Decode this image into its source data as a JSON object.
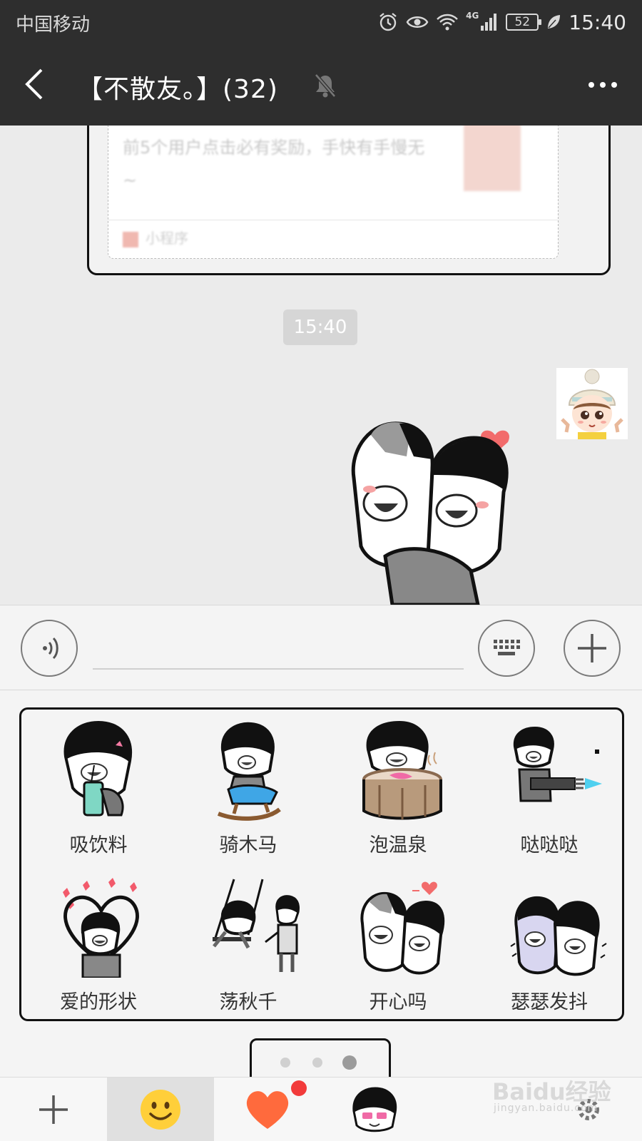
{
  "status_bar": {
    "carrier": "中国移动",
    "network_tag": "4G",
    "battery": "52",
    "time": "15:40"
  },
  "header": {
    "title": "【不散友。】(32)",
    "icons": [
      "back-arrow-icon",
      "mute-bell-icon",
      "more-dots-icon"
    ]
  },
  "chat": {
    "card_text": "前5个用户点击必有奖励，手快有手慢无~",
    "card_source": "小程序",
    "timestamp": "15:40"
  },
  "input": {
    "value": "",
    "icons": [
      "voice-icon",
      "keyboard-icon",
      "plus-icon"
    ]
  },
  "stickers": [
    {
      "label": "吸饮料"
    },
    {
      "label": "骑木马"
    },
    {
      "label": "泡温泉"
    },
    {
      "label": "哒哒哒"
    },
    {
      "label": "爱的形状"
    },
    {
      "label": "荡秋千"
    },
    {
      "label": "开心吗"
    },
    {
      "label": "瑟瑟发抖"
    }
  ],
  "pager": {
    "pages": 3,
    "current": 3
  },
  "tabbar": {
    "tabs": [
      "add-icon",
      "smiley-emoji-icon",
      "heart-icon",
      "mushroom-head-sticker-icon",
      "settings-gear-icon"
    ],
    "selected": "smiley-emoji-icon",
    "heart_tab_has_badge": true
  },
  "watermark": {
    "logo": "Baidu经验",
    "url": "jingyan.baidu.com"
  },
  "colors": {
    "header_bg": "#2e2e2e",
    "chat_bg": "#ebebeb",
    "badge_red": "#f23b3b",
    "emoji_yellow": "#ffcf3a",
    "heart_orange": "#ff6a3d"
  }
}
